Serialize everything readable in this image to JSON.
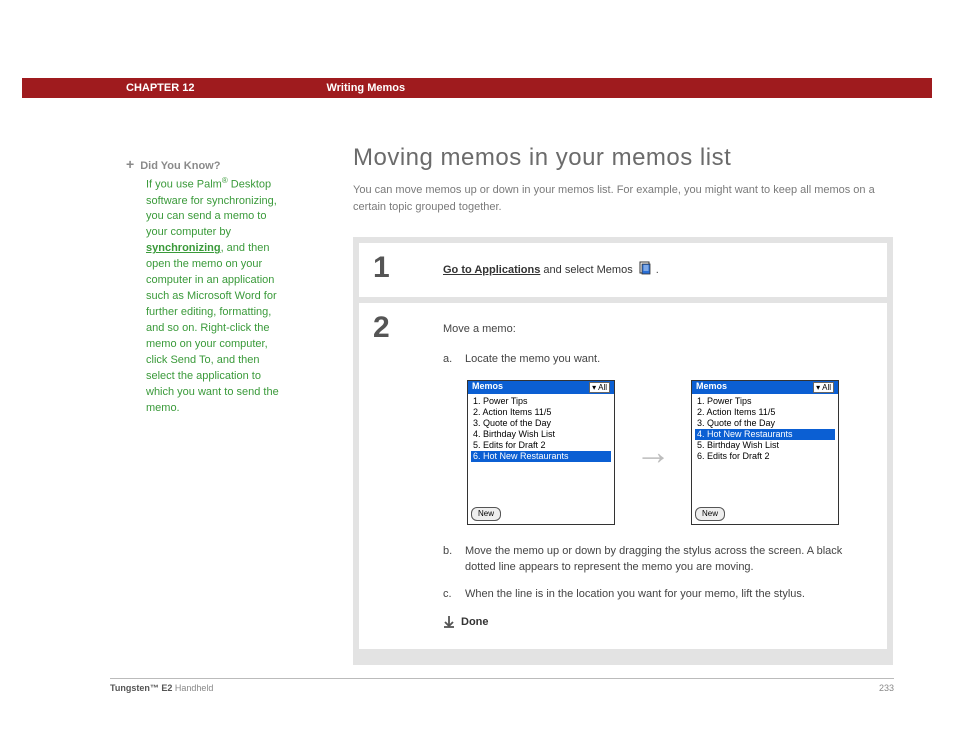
{
  "header": {
    "chapter": "CHAPTER 12",
    "section": "Writing Memos"
  },
  "sidebar": {
    "plus": "+",
    "dyk": "Did You Know?",
    "tip_p1": "If you use Palm",
    "tip_reg": "®",
    "tip_p2": " Desktop software for synchronizing, you can send a memo to your computer by ",
    "tip_link": "synchronizing",
    "tip_p3": ", and then open the memo on your computer in an application such as Microsoft Word for further editing, formatting, and so on. Right-click the memo on your computer, click Send To, and then select the application to which you want to send the memo."
  },
  "main": {
    "title": "Moving memos in your memos list",
    "intro": "You can move memos up or down in your memos list. For example, you might want to keep all memos on a certain topic grouped together."
  },
  "step1": {
    "num": "1",
    "goapps": "Go to Applications",
    "rest": " and select Memos ",
    "period": "."
  },
  "step2": {
    "num": "2",
    "lead": "Move a memo:",
    "a_letter": "a.",
    "a_text": "Locate the memo you want.",
    "b_letter": "b.",
    "b_text": "Move the memo up or down by dragging the stylus across the screen. A black dotted line appears to represent the memo you are moving.",
    "c_letter": "c.",
    "c_text": "When the line is in the location you want for your memo, lift the stylus.",
    "done": "Done"
  },
  "palm": {
    "title": "Memos",
    "cat_arrow": "▾",
    "cat": "All",
    "newbtn": "New",
    "left": {
      "items": [
        "1. Power Tips",
        "2. Action Items 11/5",
        "3. Quote of the Day",
        "4. Birthday Wish List",
        "5. Edits for Draft 2",
        "6. Hot New Restaurants"
      ],
      "selected": 5
    },
    "right": {
      "items": [
        "1. Power Tips",
        "2. Action Items 11/5",
        "3. Quote of the Day",
        "4. Hot New Restaurants",
        "5. Birthday Wish List",
        "6. Edits for Draft 2"
      ],
      "selected": 3
    }
  },
  "footer": {
    "product_bold": "Tungsten™ E2",
    "product_rest": " Handheld",
    "page": "233"
  }
}
